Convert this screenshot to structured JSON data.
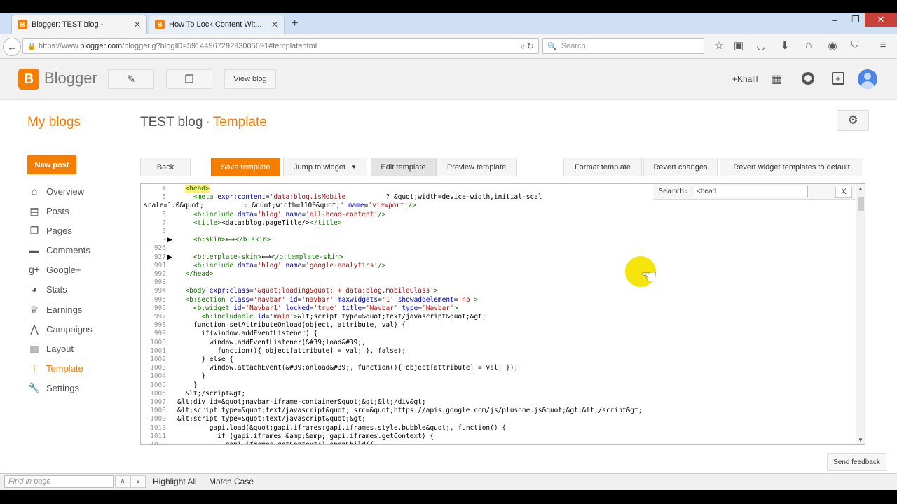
{
  "browser": {
    "tabs": [
      {
        "title": "Blogger: TEST blog -",
        "active": true
      },
      {
        "title": "How To Lock Content Wit...",
        "active": false
      }
    ],
    "url_prefix": "https://www.",
    "url_domain": "blogger.com",
    "url_rest": "/blogger.g?blogID=5914496729293005691#templatehtml",
    "search_placeholder": "Search",
    "window_controls": [
      "minimize-icon",
      "restore-icon",
      "close-icon"
    ]
  },
  "blogger_header": {
    "brand": "Blogger",
    "view_blog": "View blog",
    "user": "+Khalil"
  },
  "page": {
    "my_blogs": "My blogs",
    "blog_name": "TEST blog",
    "separator": "·",
    "section": "Template"
  },
  "sidebar": {
    "new_post": "New post",
    "items": [
      {
        "label": "Overview",
        "icon": "home-icon"
      },
      {
        "label": "Posts",
        "icon": "posts-icon"
      },
      {
        "label": "Pages",
        "icon": "pages-icon"
      },
      {
        "label": "Comments",
        "icon": "comments-icon"
      },
      {
        "label": "Google+",
        "icon": "googleplus-icon"
      },
      {
        "label": "Stats",
        "icon": "stats-icon"
      },
      {
        "label": "Earnings",
        "icon": "trophy-icon"
      },
      {
        "label": "Campaigns",
        "icon": "campaigns-icon"
      },
      {
        "label": "Layout",
        "icon": "layout-icon"
      },
      {
        "label": "Template",
        "icon": "template-icon",
        "active": true
      },
      {
        "label": "Settings",
        "icon": "wrench-icon"
      }
    ]
  },
  "toolbar": {
    "back": "Back",
    "save_template": "Save template",
    "jump_to_widget": "Jump to widget",
    "edit_template": "Edit template",
    "preview_template": "Preview template",
    "format_template": "Format template",
    "revert_changes": "Revert changes",
    "revert_widgets": "Revert widget templates to default"
  },
  "editor": {
    "search_label": "Search:",
    "search_value": "<head",
    "close": "X",
    "line_numbers": [
      "4",
      "5",
      "",
      "6",
      "7",
      "8",
      "9",
      "926",
      "927",
      "991",
      "992",
      "993",
      "994",
      "995",
      "996",
      "997",
      "998",
      "999",
      "1000",
      "1001",
      "1002",
      "1003",
      "1004",
      "1005",
      "1006",
      "1007",
      "1008",
      "1009",
      "1010",
      "1011",
      "1012"
    ]
  },
  "feedback": "Send feedback",
  "findbar": {
    "placeholder": "Find in page",
    "highlight_all": "Highlight All",
    "match_case": "Match Case"
  },
  "colors": {
    "brand_orange": "#f57d00",
    "tab_strip": "#cfe0f4"
  }
}
